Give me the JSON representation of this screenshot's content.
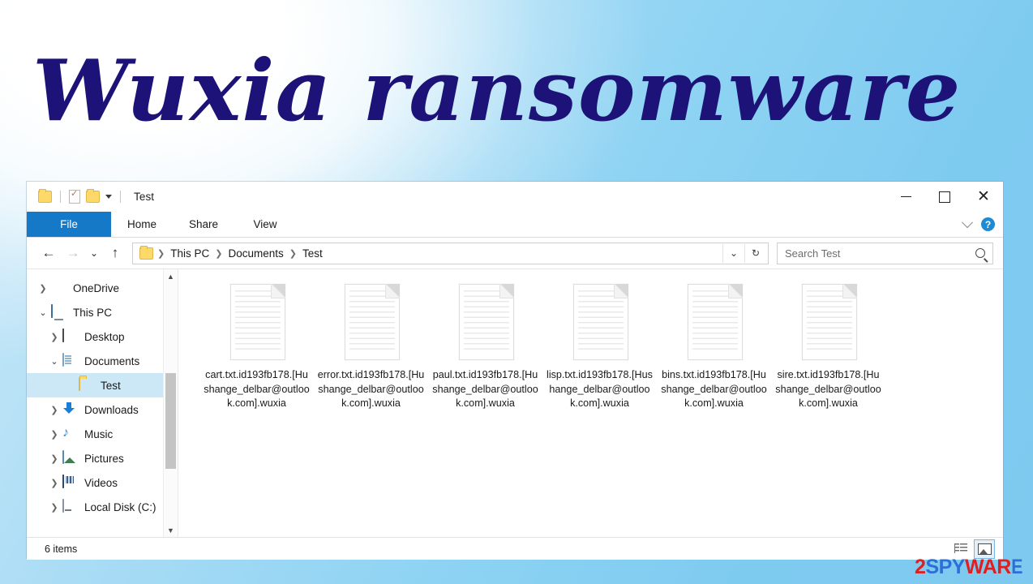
{
  "banner": {
    "title": "Wuxia ransomware",
    "title_color": "#1c1277",
    "background_top_right_color": "#7ec9ef"
  },
  "window": {
    "title": "Test",
    "quick_access": {
      "folder_icon": "folder-icon",
      "properties_icon": "properties-icon",
      "new_folder_icon": "new-folder-icon",
      "customize_chevron": "chevron-down-icon"
    },
    "controls": {
      "minimize": "minimize-icon",
      "maximize": "maximize-icon",
      "close": "close-icon"
    }
  },
  "ribbon": {
    "tabs": [
      {
        "label": "File",
        "active_style": "blue"
      },
      {
        "label": "Home",
        "active_style": "normal"
      },
      {
        "label": "Share",
        "active_style": "normal"
      },
      {
        "label": "View",
        "active_style": "normal"
      }
    ],
    "expand_chevron": "chevron-down-icon",
    "help_label": "?",
    "file_tab_color": "#1579c8"
  },
  "address_bar": {
    "back_icon": "back-arrow-icon",
    "forward_icon": "forward-arrow-icon",
    "recent_icon": "chevron-down-icon",
    "up_icon": "up-arrow-icon",
    "folder_icon": "folder-icon",
    "breadcrumbs": [
      "This PC",
      "Documents",
      "Test"
    ],
    "separator": "›",
    "dropdown_icon": "chevron-down-icon",
    "refresh_icon": "refresh-icon"
  },
  "search": {
    "placeholder": "Search Test",
    "icon": "search-icon"
  },
  "nav_pane": {
    "items": [
      {
        "label": "OneDrive",
        "icon": "onedrive-icon",
        "indent": 0,
        "twisty": "collapsed",
        "selected": false
      },
      {
        "label": "This PC",
        "icon": "thispc-icon",
        "indent": 0,
        "twisty": "expanded",
        "selected": false
      },
      {
        "label": "Desktop",
        "icon": "desktop-icon",
        "indent": 1,
        "twisty": "collapsed",
        "selected": false
      },
      {
        "label": "Documents",
        "icon": "documents-icon",
        "indent": 1,
        "twisty": "expanded",
        "selected": false
      },
      {
        "label": "Test",
        "icon": "folder-icon",
        "indent": 2,
        "twisty": "none",
        "selected": true
      },
      {
        "label": "Downloads",
        "icon": "downloads-icon",
        "indent": 1,
        "twisty": "collapsed",
        "selected": false
      },
      {
        "label": "Music",
        "icon": "music-icon",
        "indent": 1,
        "twisty": "collapsed",
        "selected": false
      },
      {
        "label": "Pictures",
        "icon": "pictures-icon",
        "indent": 1,
        "twisty": "collapsed",
        "selected": false
      },
      {
        "label": "Videos",
        "icon": "videos-icon",
        "indent": 1,
        "twisty": "collapsed",
        "selected": false
      },
      {
        "label": "Local Disk (C:)",
        "icon": "disk-icon",
        "indent": 1,
        "twisty": "collapsed",
        "selected": false
      }
    ],
    "selection_color": "#cce8f7",
    "scroll_up_icon": "chevron-up-icon",
    "scroll_down_icon": "chevron-down-icon"
  },
  "files": [
    {
      "name": "cart.txt.id193fb178.[Hushange_delbar@outlook.com].wuxia",
      "icon": "text-file-icon"
    },
    {
      "name": "error.txt.id193fb178.[Hushange_delbar@outlook.com].wuxia",
      "icon": "text-file-icon"
    },
    {
      "name": "paul.txt.id193fb178.[Hushange_delbar@outlook.com].wuxia",
      "icon": "text-file-icon"
    },
    {
      "name": "lisp.txt.id193fb178.[Hushange_delbar@outlook.com].wuxia",
      "icon": "text-file-icon"
    },
    {
      "name": "bins.txt.id193fb178.[Hushange_delbar@outlook.com].wuxia",
      "icon": "text-file-icon"
    },
    {
      "name": "sire.txt.id193fb178.[Hushange_delbar@outlook.com].wuxia",
      "icon": "text-file-icon"
    }
  ],
  "status_bar": {
    "item_count": "6 items",
    "view_buttons": [
      {
        "name": "details-view-button",
        "active": false
      },
      {
        "name": "large-icons-view-button",
        "active": true
      }
    ]
  },
  "watermark": {
    "part1": "2",
    "part2": "SPY",
    "part3": "WAR",
    "part4": "E",
    "red": "#e02020",
    "blue": "#2d6fd8"
  }
}
